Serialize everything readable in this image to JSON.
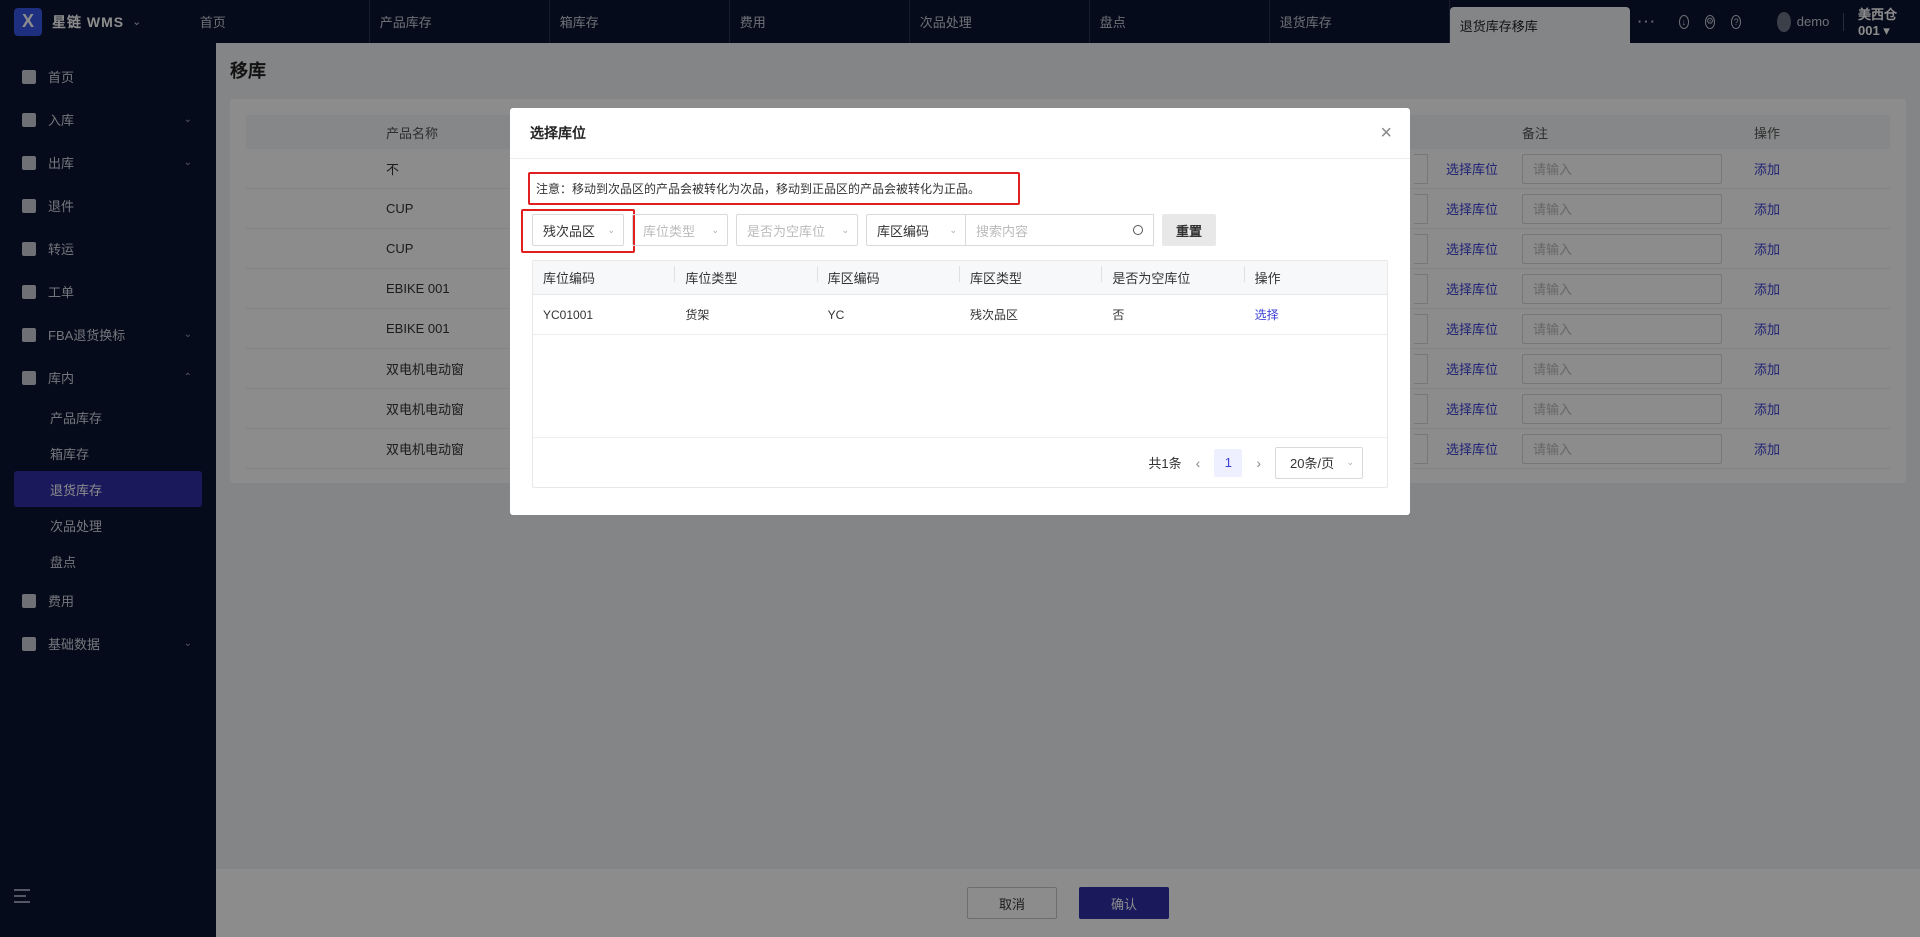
{
  "brand": {
    "logo": "X",
    "name": "星链  WMS"
  },
  "nav_tabs": [
    "首页",
    "产品库存",
    "箱库存",
    "费用",
    "次品处理",
    "盘点",
    "退货库存",
    "退货库存移库"
  ],
  "topbar": {
    "more": "···",
    "user": "demo",
    "warehouse": "美西仓001 ▾"
  },
  "sidebar": {
    "items": [
      {
        "label": "首页",
        "icon": "home-icon"
      },
      {
        "label": "入库",
        "icon": "inbound-icon"
      },
      {
        "label": "出库",
        "icon": "outbound-icon"
      },
      {
        "label": "退件",
        "icon": "return-icon"
      },
      {
        "label": "转运",
        "icon": "truck-icon"
      },
      {
        "label": "工单",
        "icon": "workorder-icon"
      },
      {
        "label": "FBA退货换标",
        "icon": "fba-icon"
      },
      {
        "label": "库内",
        "icon": "warehouse-icon"
      }
    ],
    "sub_items": [
      "产品库存",
      "箱库存",
      "退货库存",
      "次品处理",
      "盘点"
    ],
    "bottom_items": [
      {
        "label": "费用",
        "icon": "fee-icon"
      },
      {
        "label": "基础数据",
        "icon": "data-icon"
      }
    ]
  },
  "page": {
    "title": "移库"
  },
  "bg_table": {
    "col_name": "产品名称",
    "col_remark": "备注",
    "col_op": "操作",
    "rows": [
      "不",
      "CUP",
      "CUP",
      "EBIKE 001",
      "EBIKE 001",
      "双电机电动窗",
      "双电机电动窗",
      "双电机电动窗"
    ],
    "pick_label": "选择库位",
    "input_placeholder": "请输入",
    "add_label": "添加"
  },
  "footer": {
    "cancel": "取消",
    "confirm": "确认"
  },
  "modal": {
    "title": "选择库位",
    "close": "×",
    "notice": "注意：移动到次品区的产品会被转化为次品，移动到正品区的产品会被转化为正品。",
    "filters": {
      "zone_type_value": "残次品区",
      "location_type_placeholder": "库位类型",
      "empty_placeholder": "是否为空库位",
      "search_field": "库区编码",
      "search_placeholder": "搜索内容",
      "reset": "重置"
    },
    "table": {
      "headers": [
        "库位编码",
        "库位类型",
        "库区编码",
        "库区类型",
        "是否为空库位",
        "操作"
      ],
      "rows": [
        {
          "code": "YC01001",
          "type": "货架",
          "zone_code": "YC",
          "zone_type": "残次品区",
          "is_empty": "否",
          "action": "选择"
        }
      ]
    },
    "pager": {
      "total": "共1条",
      "prev": "‹",
      "page": "1",
      "next": "›",
      "size": "20条/页"
    }
  }
}
